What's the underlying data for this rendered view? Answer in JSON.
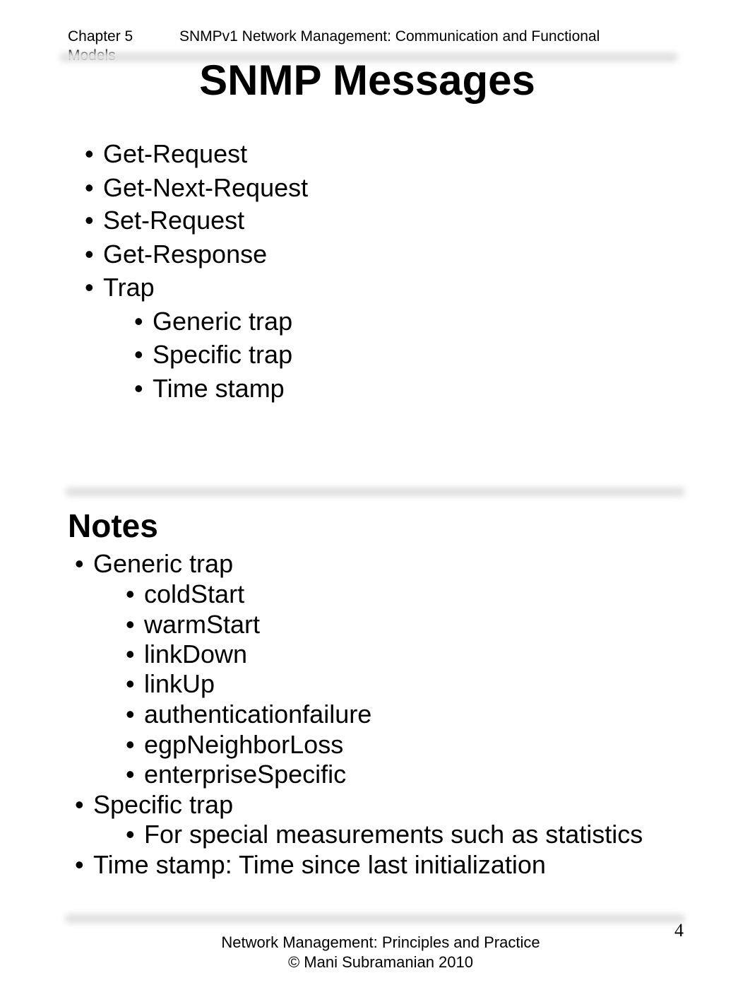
{
  "header": {
    "chapter": "Chapter 5",
    "subtitle": "SNMPv1 Network Management:  Communication and Functional",
    "subtitle_cont": "Models"
  },
  "slide": {
    "title": "SNMP Messages",
    "bullets": [
      "Get-Request",
      "Get-Next-Request",
      "Set-Request",
      "Get-Response",
      "Trap"
    ],
    "trap_sub": [
      "Generic trap",
      "Specific trap",
      "Time stamp"
    ]
  },
  "notes": {
    "heading": "Notes",
    "items": [
      {
        "text": "Generic trap",
        "sub": [
          "coldStart",
          "warmStart",
          "linkDown",
          "linkUp",
          "authenticationfailure",
          "egpNeighborLoss",
          "enterpriseSpecific"
        ]
      },
      {
        "text": "Specific trap",
        "sub": [
          "For special measurements such as statistics"
        ]
      },
      {
        "text": "Time stamp: Time since last initialization",
        "sub": []
      }
    ]
  },
  "footer": {
    "line1": "Network Management: Principles and Practice",
    "line2": "©  Mani Subramanian 2010",
    "page_number": "4"
  },
  "bullet_glyph": "•"
}
